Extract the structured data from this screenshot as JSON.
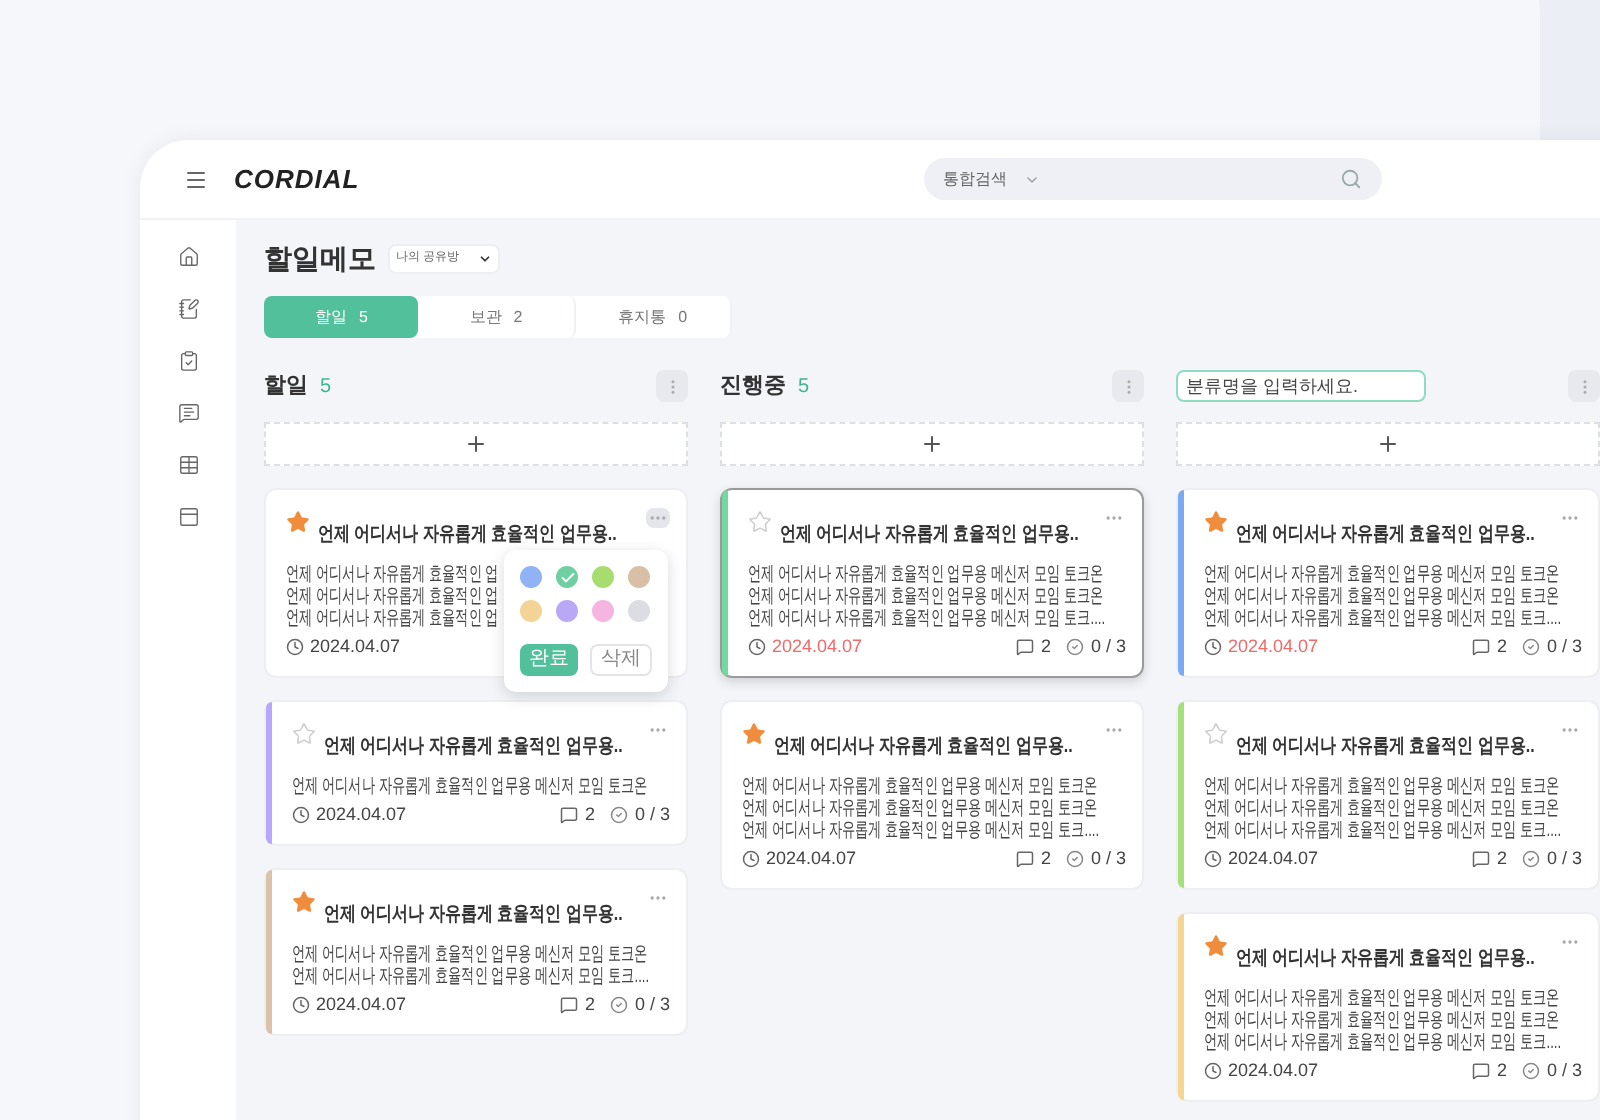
{
  "header": {
    "logo": "CORDIAL",
    "search": {
      "scope": "통합검색"
    }
  },
  "page": {
    "title": "할일메모",
    "room_select": "나의 공유방"
  },
  "tabs": [
    {
      "label": "할일",
      "count": "5",
      "selected": true
    },
    {
      "label": "보관",
      "count": "2",
      "selected": false
    },
    {
      "label": "휴지통",
      "count": "0",
      "selected": false
    }
  ],
  "columns": [
    {
      "kind": "title",
      "name": "할일",
      "count": "5",
      "cards": [
        {
          "starred": true,
          "selected": false,
          "menu_open": true,
          "title": "언제 어디서나 자유롭게 효율적인 업무용..",
          "lines": [
            "언제 어디서나 자유롭게 효율적인 업",
            "언제 어디서나 자유롭게 효율적인 업",
            "언제 어디서나 자유롭게 효율적인 업"
          ],
          "date": "2024.04.07",
          "overdue": false
        },
        {
          "starred": false,
          "color": "#b9a6ff",
          "selected": false,
          "menu_open": false,
          "title": "언제 어디서나 자유롭게 효율적인 업무용..",
          "lines": [
            "언제 어디서나 자유롭게 효율적인 업무용 메신저 모임 토크온"
          ],
          "date": "2024.04.07",
          "overdue": false,
          "comments": "2",
          "checks": "0 / 3"
        },
        {
          "starred": true,
          "color": "#dcc0a8",
          "selected": false,
          "menu_open": false,
          "title": "언제 어디서나 자유롭게 효율적인 업무용..",
          "lines": [
            "언제 어디서나 자유롭게 효율적인 업무용 메신저 모임 토크온",
            "언제 어디서나 자유롭게 효율적인 업무용 메신저 모임 토크...."
          ],
          "date": "2024.04.07",
          "overdue": false,
          "comments": "2",
          "checks": "0 / 3"
        }
      ]
    },
    {
      "kind": "title",
      "name": "진행중",
      "count": "5",
      "cards": [
        {
          "starred": false,
          "color": "#6fdaa0",
          "selected": true,
          "menu_open": false,
          "title": "언제 어디서나 자유롭게 효율적인 업무용..",
          "lines": [
            "언제 어디서나 자유롭게 효율적인 업무용 메신저 모임 토크온",
            "언제 어디서나 자유롭게 효율적인 업무용 메신저 모임 토크온",
            "언제 어디서나 자유롭게 효율적인 업무용 메신저 모임 토크...."
          ],
          "date": "2024.04.07",
          "overdue": true,
          "comments": "2",
          "checks": "0 / 3"
        },
        {
          "starred": true,
          "selected": false,
          "menu_open": false,
          "title": "언제 어디서나 자유롭게 효율적인 업무용..",
          "lines": [
            "언제 어디서나 자유롭게 효율적인 업무용 메신저 모임 토크온",
            "언제 어디서나 자유롭게 효율적인 업무용 메신저 모임 토크온",
            "언제 어디서나 자유롭게 효율적인 업무용 메신저 모임 토크...."
          ],
          "date": "2024.04.07",
          "overdue": false,
          "comments": "2",
          "checks": "0 / 3"
        }
      ]
    },
    {
      "kind": "input",
      "placeholder": "분류명을 입력하세요.",
      "cards": [
        {
          "starred": true,
          "color": "#7aaaf5",
          "selected": false,
          "menu_open": false,
          "title": "언제 어디서나 자유롭게 효율적인 업무용..",
          "lines": [
            "언제 어디서나 자유롭게 효율적인 업무용 메신저 모임 토크온",
            "언제 어디서나 자유롭게 효율적인 업무용 메신저 모임 토크온",
            "언제 어디서나 자유롭게 효율적인 업무용 메신저 모임 토크...."
          ],
          "date": "2024.04.07",
          "overdue": true,
          "comments": "2",
          "checks": "0 / 3"
        },
        {
          "starred": false,
          "color": "#a6e07a",
          "selected": false,
          "menu_open": false,
          "title": "언제 어디서나 자유롭게 효율적인 업무용..",
          "lines": [
            "언제 어디서나 자유롭게 효율적인 업무용 메신저 모임 토크온",
            "언제 어디서나 자유롭게 효율적인 업무용 메신저 모임 토크온",
            "언제 어디서나 자유롭게 효율적인 업무용 메신저 모임 토크...."
          ],
          "date": "2024.04.07",
          "overdue": false,
          "comments": "2",
          "checks": "0 / 3"
        },
        {
          "starred": true,
          "color": "#f5d58f",
          "selected": false,
          "menu_open": false,
          "title": "언제 어디서나 자유롭게 효율적인 업무용..",
          "lines": [
            "언제 어디서나 자유롭게 효율적인 업무용 메신저 모임 토크온",
            "언제 어디서나 자유롭게 효율적인 업무용 메신저 모임 토크온",
            "언제 어디서나 자유롭게 효율적인 업무용 메신저 모임 토크...."
          ],
          "date": "2024.04.07",
          "overdue": false,
          "comments": "2",
          "checks": "0 / 3"
        }
      ]
    }
  ],
  "color_menu": {
    "swatches": [
      {
        "color": "#8fb3f5",
        "checked": false
      },
      {
        "color": "#6fcfa2",
        "checked": true
      },
      {
        "color": "#a6dd6e",
        "checked": false
      },
      {
        "color": "#d9bfa6",
        "checked": false
      },
      {
        "color": "#f3d496",
        "checked": false
      },
      {
        "color": "#b8a8f5",
        "checked": false
      },
      {
        "color": "#f5b5e0",
        "checked": false
      },
      {
        "color": "#dcdde3",
        "checked": false
      }
    ],
    "buttons": [
      {
        "kind": "primary",
        "label": "완료"
      },
      {
        "kind": "secondary",
        "label": "삭제"
      }
    ]
  }
}
